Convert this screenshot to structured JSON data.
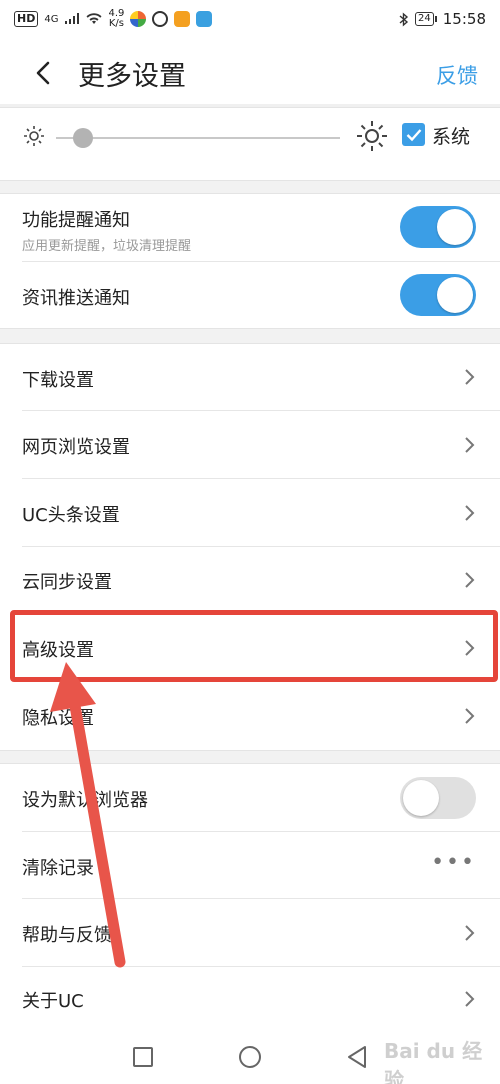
{
  "status_bar": {
    "left_badge": "HD",
    "signal_label": "4G",
    "speed_value": "4.9",
    "speed_unit": "K/s",
    "battery": "24",
    "time": "15:58"
  },
  "header": {
    "title": "更多设置",
    "feedback_label": "反馈"
  },
  "brightness": {
    "level": 0.06,
    "system_checked": true,
    "system_label": "系统"
  },
  "notifications": [
    {
      "label": "功能提醒通知",
      "sub": "应用更新提醒，垃圾清理提醒",
      "on": true
    },
    {
      "label": "资讯推送通知",
      "on": true
    }
  ],
  "settings": [
    {
      "label": "下载设置"
    },
    {
      "label": "网页浏览设置"
    },
    {
      "label": "UC头条设置"
    },
    {
      "label": "云同步设置"
    },
    {
      "label": "高级设置"
    },
    {
      "label": "隐私设置"
    }
  ],
  "misc": [
    {
      "label": "设为默认浏览器",
      "control": "toggle",
      "on": false
    },
    {
      "label": "清除记录",
      "control": "more"
    },
    {
      "label": "帮助与反馈",
      "control": "chevron"
    },
    {
      "label": "关于UC",
      "control": "chevron"
    }
  ],
  "more_dots": "•••",
  "watermark": "Bai du 经验",
  "colors": {
    "accent": "#3b9ee6",
    "highlight": "#e5453a",
    "annotation_arrow": "#e8554a"
  }
}
